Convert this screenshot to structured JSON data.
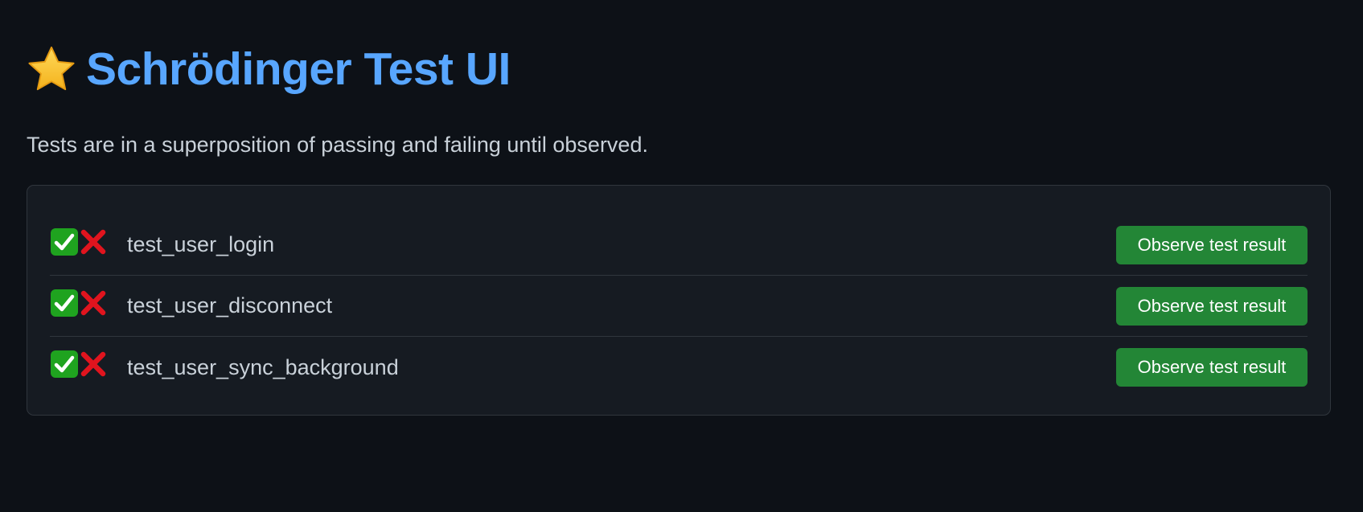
{
  "header": {
    "icon": "star-icon",
    "title": "Schrödinger Test UI"
  },
  "description": "Tests are in a superposition of passing and failing until observed.",
  "tests": [
    {
      "name": "test_user_login",
      "status_icons": [
        "check-mark-icon",
        "cross-mark-icon"
      ],
      "button_label": "Observe test result"
    },
    {
      "name": "test_user_disconnect",
      "status_icons": [
        "check-mark-icon",
        "cross-mark-icon"
      ],
      "button_label": "Observe test result"
    },
    {
      "name": "test_user_sync_background",
      "status_icons": [
        "check-mark-icon",
        "cross-mark-icon"
      ],
      "button_label": "Observe test result"
    }
  ],
  "colors": {
    "background": "#0d1117",
    "card": "#161b22",
    "border": "#30363d",
    "title": "#58a6ff",
    "text": "#c9d1d9",
    "button": "#238636",
    "check": "#1fa31f",
    "cross": "#e0141e",
    "star": "#f7c531"
  }
}
